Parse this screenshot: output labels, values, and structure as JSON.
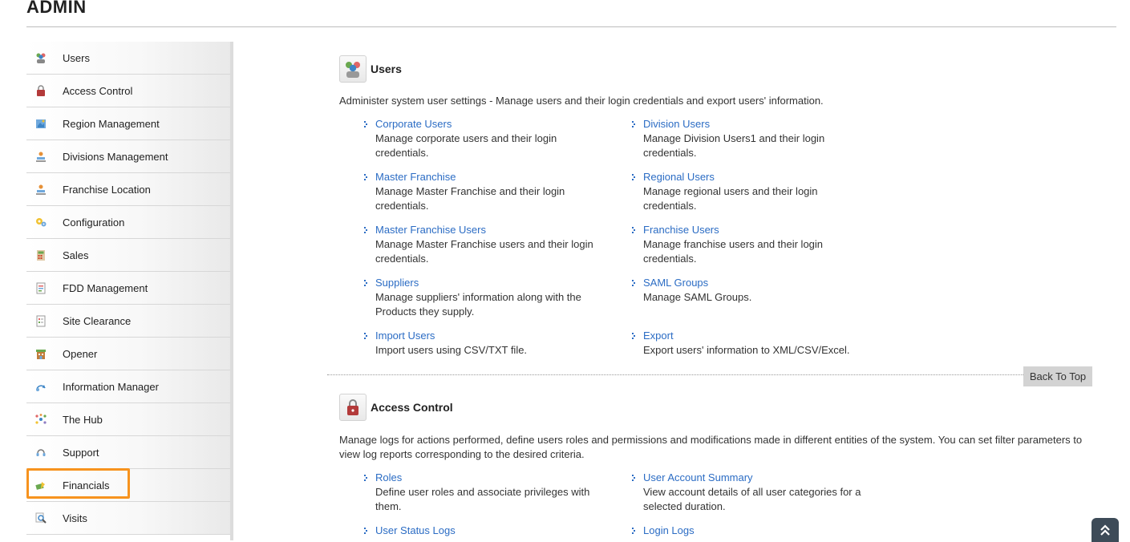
{
  "header": {
    "title": "ADMIN"
  },
  "sidebar": {
    "items": [
      {
        "label": "Users",
        "icon": "users-icon"
      },
      {
        "label": "Access Control",
        "icon": "lock-icon"
      },
      {
        "label": "Region Management",
        "icon": "map-icon"
      },
      {
        "label": "Divisions Management",
        "icon": "division-icon"
      },
      {
        "label": "Franchise Location",
        "icon": "location-icon"
      },
      {
        "label": "Configuration",
        "icon": "gears-icon"
      },
      {
        "label": "Sales",
        "icon": "calculator-icon"
      },
      {
        "label": "FDD Management",
        "icon": "document-icon"
      },
      {
        "label": "Site Clearance",
        "icon": "checklist-icon"
      },
      {
        "label": "Opener",
        "icon": "store-icon"
      },
      {
        "label": "Information Manager",
        "icon": "info-flow-icon"
      },
      {
        "label": "The Hub",
        "icon": "hub-icon"
      },
      {
        "label": "Support",
        "icon": "support-icon"
      },
      {
        "label": "Financials",
        "icon": "financials-icon"
      },
      {
        "label": "Visits",
        "icon": "magnifier-icon"
      }
    ],
    "highlighted": "Financials"
  },
  "users_section": {
    "title": "Users",
    "description": "Administer system user settings - Manage users and their login credentials and export users' information.",
    "links": [
      {
        "title": "Corporate Users",
        "desc": "Manage corporate users and their login credentials."
      },
      {
        "title": "Division Users",
        "desc": "Manage Division Users1 and their login credentials."
      },
      {
        "title": "Master Franchise",
        "desc": "Manage Master Franchise and their login credentials."
      },
      {
        "title": "Regional Users",
        "desc": "Manage regional users and their login credentials."
      },
      {
        "title": "Master Franchise Users",
        "desc": "Manage Master Franchise users and their login credentials."
      },
      {
        "title": "Franchise Users",
        "desc": "Manage franchise users and their login credentials."
      },
      {
        "title": "Suppliers",
        "desc": "Manage suppliers' information along with the Products they supply."
      },
      {
        "title": "SAML Groups",
        "desc": "Manage SAML Groups."
      },
      {
        "title": "Import Users",
        "desc": "Import users using CSV/TXT file."
      },
      {
        "title": "Export",
        "desc": "Export users' information to XML/CSV/Excel."
      }
    ]
  },
  "back_to_top": "Back To Top",
  "access_section": {
    "title": "Access Control",
    "description": "Manage logs for actions performed, define users roles and permissions and modifications made in different entities of the system. You can set filter parameters to view log reports corresponding to the desired criteria.",
    "links": [
      {
        "title": "Roles",
        "desc": "Define user roles and associate privileges with them."
      },
      {
        "title": "User Account Summary",
        "desc": "View account details of all user categories for a selected duration."
      },
      {
        "title": "User Status Logs",
        "desc": ""
      },
      {
        "title": "Login Logs",
        "desc": ""
      }
    ]
  },
  "colors": {
    "link": "#2b6cc4",
    "highlight": "#f7931e",
    "scroll_button": "#3d4b58"
  }
}
